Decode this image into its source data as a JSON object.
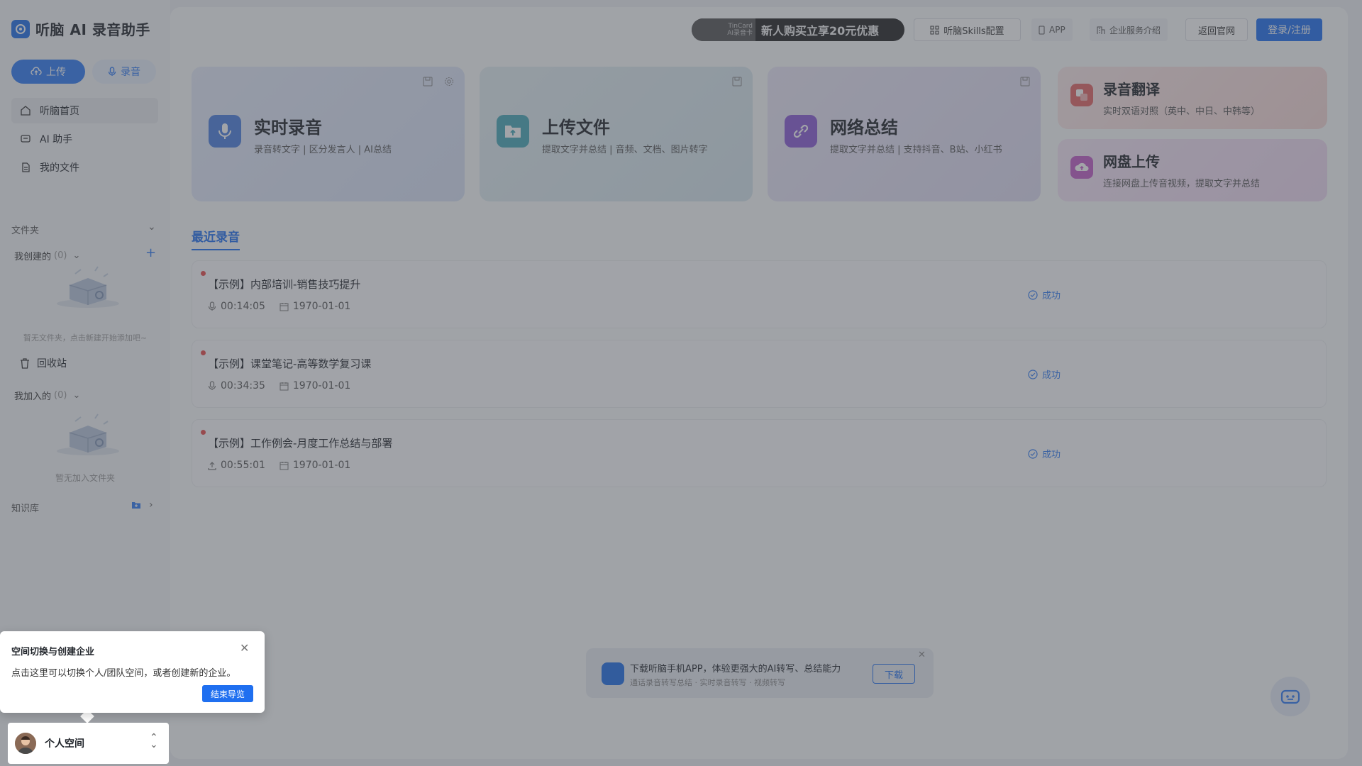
{
  "app": {
    "title": "听脑 AI 录音助手"
  },
  "sidebar": {
    "upload_label": "上传",
    "record_label": "录音",
    "nav": [
      {
        "label": "听脑首页",
        "icon": "home-icon"
      },
      {
        "label": "AI 助手",
        "icon": "chat-icon"
      },
      {
        "label": "我的文件",
        "icon": "file-icon"
      }
    ],
    "folder_section": "文件夹",
    "created_label": "我创建的",
    "created_count": "(0)",
    "created_empty": "暂无文件夹，点击新建开始添加吧~",
    "recycle_label": "回收站",
    "joined_label": "我加入的",
    "joined_count": "(0)",
    "joined_empty": "暂无加入文件夹",
    "knowledge_label": "知识库"
  },
  "topbar": {
    "promo_tag_line1": "TinCard",
    "promo_tag_line2": "AI录音卡",
    "promo_text": "新人购买立享20元优惠",
    "skills_label": "听脑Skills配置",
    "app_label": "APP",
    "enterprise_label": "企业服务介绍",
    "back_label": "返回官网",
    "login_label": "登录/注册"
  },
  "cards": [
    {
      "title": "实时录音",
      "subtitle": "录音转文字 | 区分发言人 | AI总结",
      "color": "#4a7fe0"
    },
    {
      "title": "上传文件",
      "subtitle": "提取文字并总结 | 音频、文档、图片转字",
      "color": "#47a8b8"
    },
    {
      "title": "网络总结",
      "subtitle": "提取文字并总结 | 支持抖音、B站、小红书",
      "color": "#8a5bd6"
    }
  ],
  "small_cards": [
    {
      "title": "录音翻译",
      "subtitle": "实时双语对照（英中、中日、中韩等）",
      "color": "#e56565"
    },
    {
      "title": "网盘上传",
      "subtitle": "连接网盘上传音视频，提取文字并总结",
      "color": "#c35cc9"
    }
  ],
  "recent_tab": "最近录音",
  "recordings": [
    {
      "title": "【示例】内部培训-销售技巧提升",
      "duration": "00:14:05",
      "date": "1970-01-01",
      "status": "成功"
    },
    {
      "title": "【示例】课堂笔记-高等数学复习课",
      "duration": "00:34:35",
      "date": "1970-01-01",
      "status": "成功"
    },
    {
      "title": "【示例】工作例会-月度工作总结与部署",
      "duration": "00:55:01",
      "date": "1970-01-01",
      "status": "成功"
    }
  ],
  "app_banner": {
    "title": "下载听脑手机APP，体验更强大的AI转写、总结能力",
    "subtitle": "通话录音转写总结 · 实时录音转写 · 视频转写",
    "button": "下载"
  },
  "tour": {
    "title": "空间切换与创建企业",
    "text": "点击这里可以切换个人/团队空间，或者创建新的企业。",
    "end_button": "结束导览"
  },
  "space": {
    "label": "个人空间"
  },
  "colors": {
    "accent": "#1f6ff0",
    "success": "#2f7bf5",
    "dot": "#e84a4a"
  }
}
